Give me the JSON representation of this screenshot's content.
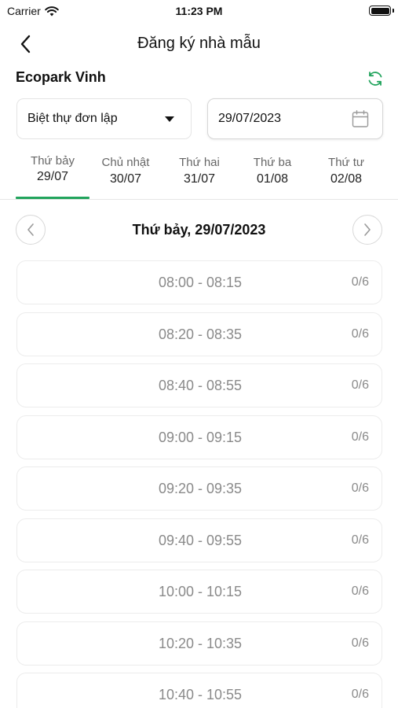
{
  "status_bar": {
    "carrier": "Carrier",
    "time": "11:23 PM"
  },
  "header": {
    "title": "Đăng ký nhà mẫu"
  },
  "project": {
    "name": "Ecopark Vinh"
  },
  "filters": {
    "house_type": "Biệt thự đơn lập",
    "date": "29/07/2023"
  },
  "day_tabs": [
    {
      "day": "Thứ bảy",
      "date": "29/07",
      "active": true
    },
    {
      "day": "Chủ nhật",
      "date": "30/07",
      "active": false
    },
    {
      "day": "Thứ hai",
      "date": "31/07",
      "active": false
    },
    {
      "day": "Thứ ba",
      "date": "01/08",
      "active": false
    },
    {
      "day": "Thứ tư",
      "date": "02/08",
      "active": false
    }
  ],
  "selected_day": {
    "title": "Thứ bảy, 29/07/2023"
  },
  "slots": [
    {
      "time": "08:00 - 08:15",
      "count": "0/6"
    },
    {
      "time": "08:20 - 08:35",
      "count": "0/6"
    },
    {
      "time": "08:40 - 08:55",
      "count": "0/6"
    },
    {
      "time": "09:00 - 09:15",
      "count": "0/6"
    },
    {
      "time": "09:20 - 09:35",
      "count": "0/6"
    },
    {
      "time": "09:40 - 09:55",
      "count": "0/6"
    },
    {
      "time": "10:00 - 10:15",
      "count": "0/6"
    },
    {
      "time": "10:20 - 10:35",
      "count": "0/6"
    },
    {
      "time": "10:40 - 10:55",
      "count": "0/6"
    }
  ],
  "icons": {
    "back": "chevron-left-icon",
    "refresh": "refresh-icon",
    "dropdown": "caret-down-icon",
    "calendar": "calendar-icon",
    "prev_day": "chevron-left-icon",
    "next_day": "chevron-right-icon",
    "wifi": "wifi-icon",
    "battery": "battery-icon"
  },
  "colors": {
    "accent": "#22a45d",
    "muted_text": "#8a8a8a",
    "border": "#ececec"
  }
}
